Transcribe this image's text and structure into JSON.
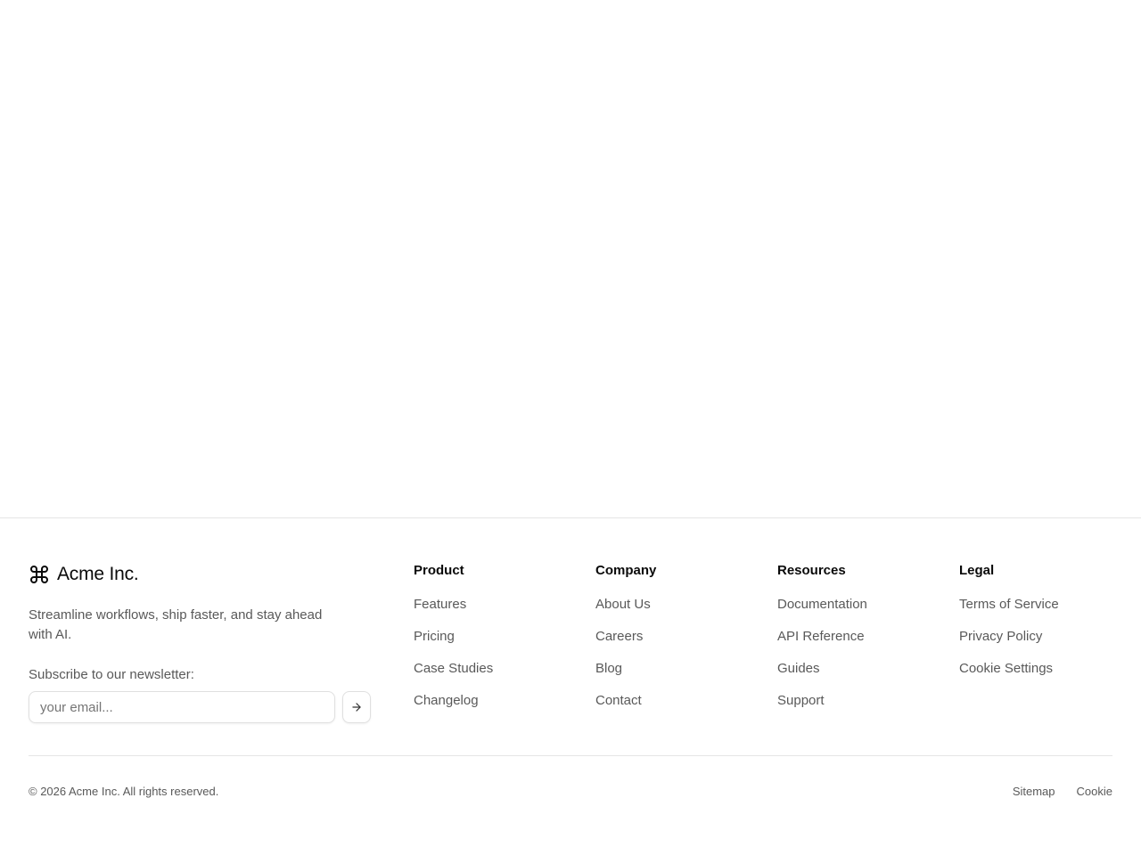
{
  "brand": {
    "name": "Acme Inc.",
    "icon": "command-icon",
    "tagline": "Streamline workflows, ship faster, and stay ahead with AI."
  },
  "newsletter": {
    "label": "Subscribe to our newsletter:",
    "placeholder": "your email...",
    "submit_icon": "arrow-right-icon"
  },
  "columns": [
    {
      "title": "Product",
      "links": [
        "Features",
        "Pricing",
        "Case Studies",
        "Changelog"
      ]
    },
    {
      "title": "Company",
      "links": [
        "About Us",
        "Careers",
        "Blog",
        "Contact"
      ]
    },
    {
      "title": "Resources",
      "links": [
        "Documentation",
        "API Reference",
        "Guides",
        "Support"
      ]
    },
    {
      "title": "Legal",
      "links": [
        "Terms of Service",
        "Privacy Policy",
        "Cookie Settings"
      ]
    }
  ],
  "bottom": {
    "copyright": "© 2026 Acme Inc. All rights reserved.",
    "links": [
      "Sitemap",
      "Cookie"
    ]
  },
  "colors": {
    "text_primary": "#0a0a0a",
    "text_muted": "#595959",
    "border": "#e5e5e5"
  }
}
